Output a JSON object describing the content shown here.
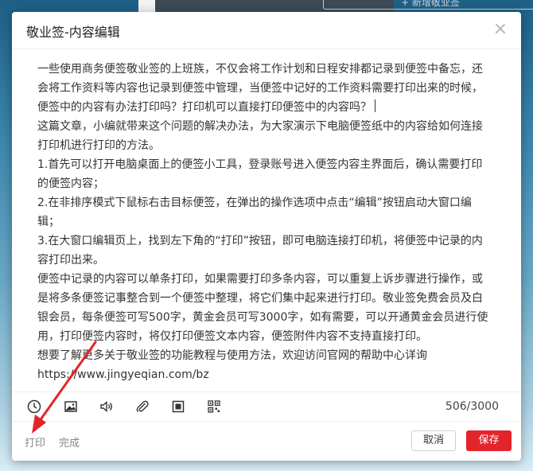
{
  "background": {
    "top_button_label": "+ 新增敬业签"
  },
  "dialog": {
    "title": "敬业签-内容编辑",
    "close_glyph": "×",
    "content": [
      "一些使用商务便签敬业签的上班族，不仅会将工作计划和日程安排都记录到便签中备忘，还会将工作资料等内容也记录到便签中管理，当便签中记好的工作资料需要打印出来的时候，便签中的内容有办法打印吗？打印机可以直接打印便签中的内容吗？",
      "这篇文章，小编就带来这个问题的解决办法，为大家演示下电脑便签纸中的内容给如何连接打印机进行打印的方法。",
      "1.首先可以打开电脑桌面上的便签小工具，登录账号进入便签内容主界面后，确认需要打印的便签内容；",
      "2.在非排序模式下鼠标右击目标便签，在弹出的操作选项中点击“编辑”按钮启动大窗口编辑；",
      "3.在大窗口编辑页上，找到左下角的“打印”按钮，即可电脑连接打印机，将便签中记录的内容打印出来。",
      "便签中记录的内容可以单条打印，如果需要打印多条内容，可以重复上诉步骤进行操作，或是将多条便签记事整合到一个便签中整理，将它们集中起来进行打印。敬业签免费会员及白银会员，每条便签可写500字，黄金会员可写3000字，如有需要，可以开通黄金会员进行使用，打印便签内容时，将仅打印便签文本内容，便签附件内容不支持直接打印。",
      "想要了解更多关于敬业签的功能教程与使用方法，欢迎访问官网的帮助中心详询https://www.jingyeqian.com/bz"
    ],
    "toolbar": {
      "icons": [
        "clock-icon",
        "image-icon",
        "audio-icon",
        "attachment-icon",
        "stop-icon",
        "qrcode-icon"
      ],
      "counter": "506/3000"
    },
    "footer": {
      "print_label": "打印",
      "done_label": "完成",
      "cancel_label": "取消",
      "save_label": "保存"
    }
  },
  "colors": {
    "accent": "#e3242b",
    "annotation_arrow": "#e3242b"
  }
}
